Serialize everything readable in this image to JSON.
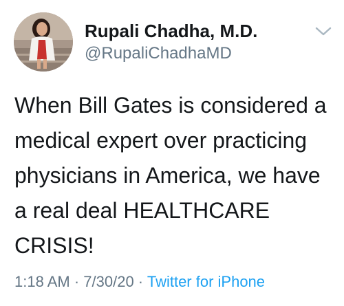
{
  "tweet": {
    "author_name": "Rupali Chadha, M.D.",
    "author_handle": "@RupaliChadhaMD",
    "text": "When Bill Gates is considered a medical expert over practicing physicians in America, we have a real deal HEALTHCARE CRISIS!",
    "time": "1:18 AM",
    "date": "7/30/20",
    "separator": " · ",
    "source": "Twitter for iPhone"
  },
  "icons": {
    "avatar": "profile-photo",
    "menu": "chevron-down-icon"
  },
  "colors": {
    "text": "#14171a",
    "secondary": "#657786",
    "link": "#1da1f2",
    "background": "#ffffff"
  }
}
